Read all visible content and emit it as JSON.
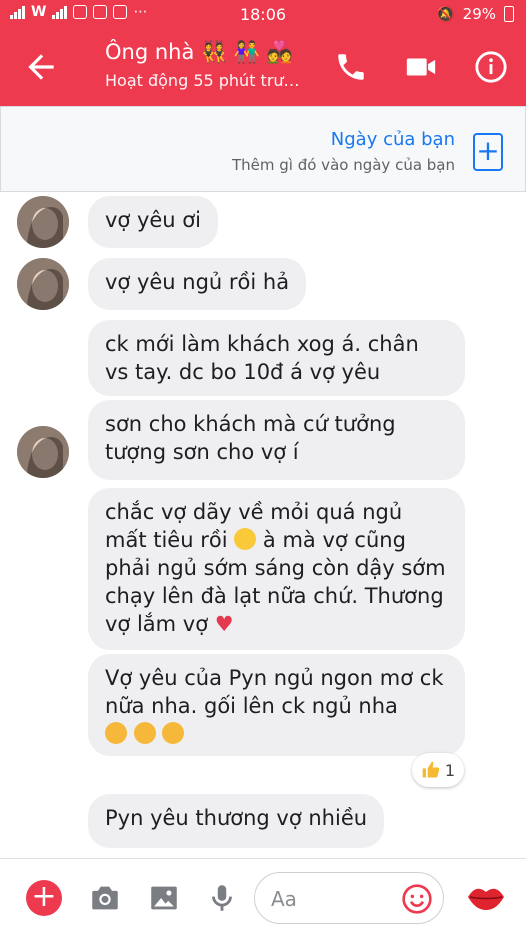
{
  "status_bar": {
    "time": "18:06",
    "battery": "29%"
  },
  "header": {
    "title": "Ông nhà 👯 👫 💑",
    "subtitle": "Hoạt động 55 phút trư…"
  },
  "day_banner": {
    "title": "Ngày của bạn",
    "subtitle": "Thêm gì đó vào ngày của bạn",
    "plus": "+"
  },
  "messages": [
    {
      "text": "vợ yêu ơi"
    },
    {
      "text": "vợ yêu ngủ rồi hả"
    },
    {
      "text": "ck mới làm khách xog á. chân vs tay. dc bo 10đ á vợ yêu"
    },
    {
      "text": "sơn cho khách mà cứ tưởng tượng sơn cho vợ í"
    },
    {
      "text": "chắc vợ dãy về mỏi quá ngủ mất tiêu rồi",
      "text2": "à mà vợ cũng phải ngủ sớm sáng còn dậy sớm chạy lên đà lạt nữa chứ. Thương vợ lắm vợ",
      "heart": "♥"
    },
    {
      "text": "Vợ yêu của Pyn ngủ ngon mơ ck nữa nha. gối lên ck ngủ nha"
    },
    {
      "text": "Pyn yêu thương vợ nhiều"
    }
  ],
  "reaction": {
    "icon": "thumbs-up",
    "count": "1"
  },
  "composer": {
    "placeholder": "Aa"
  },
  "colors": {
    "brand": "#ee3a4f",
    "bubble": "#efeff1",
    "link": "#1877f2"
  }
}
